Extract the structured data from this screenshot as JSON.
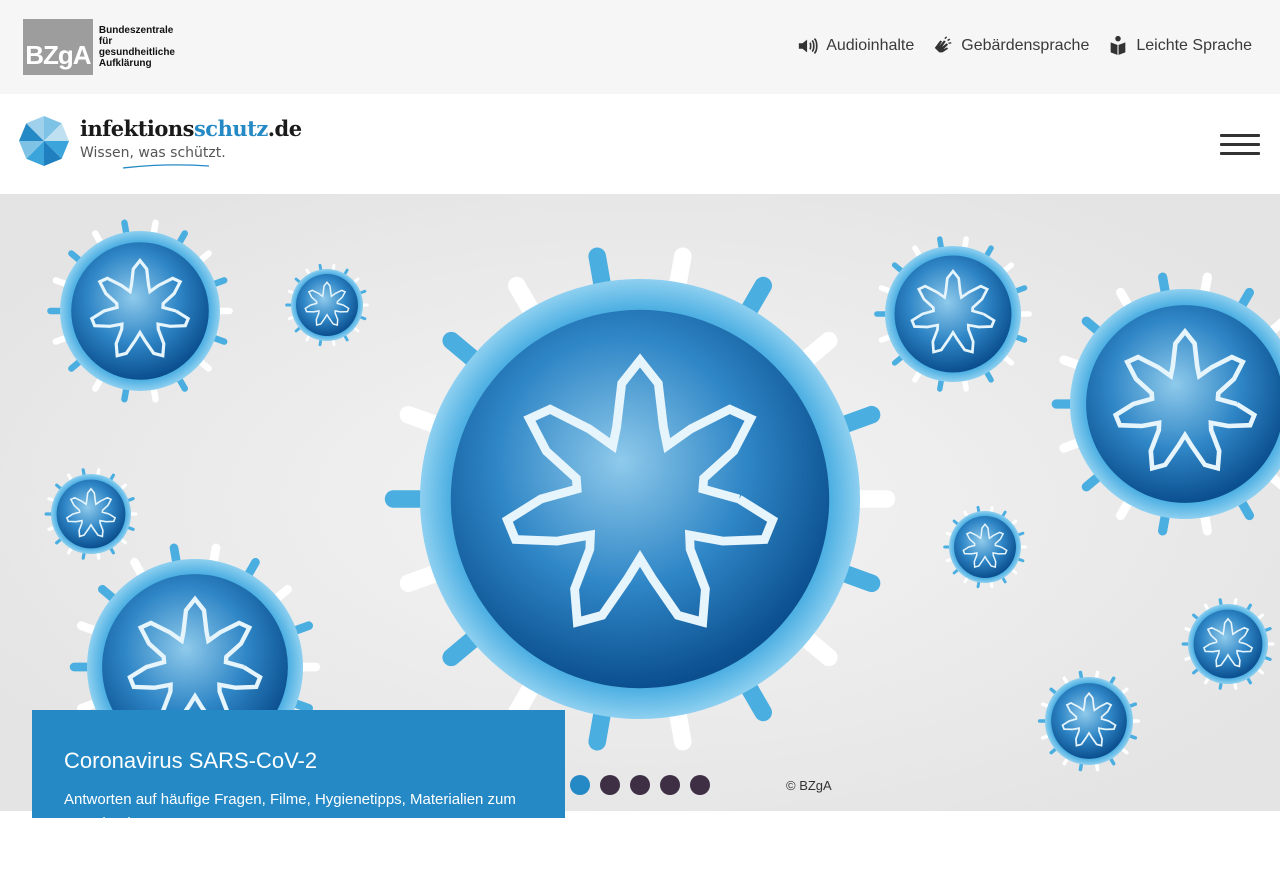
{
  "topbar": {
    "org_logo": {
      "abbr": "BZgA",
      "lines": [
        "Bundeszentrale",
        "für",
        "gesundheitliche",
        "Aufklärung"
      ]
    },
    "links": [
      {
        "label": "Audioinhalte",
        "icon": "speaker-icon"
      },
      {
        "label": "Gebärdensprache",
        "icon": "sign-language-icon"
      },
      {
        "label": "Leichte Sprache",
        "icon": "easy-language-icon"
      }
    ]
  },
  "header": {
    "site_name_main": "infektions",
    "site_name_accent": "schutz",
    "site_name_tld": ".de",
    "tagline": "Wissen, was schützt.",
    "menu_icon": "hamburger-menu-icon"
  },
  "hero": {
    "title": "Coronavirus SARS-CoV-2",
    "text": "Antworten auf häufige Fragen, Filme, Hygienetipps, Materialien zum Download",
    "copyright": "© BZgA",
    "slides_total": 5,
    "active_slide": 1,
    "colors": {
      "accent": "#2489c5",
      "dot_inactive": "#3f2f45",
      "background": "#ececec"
    }
  }
}
